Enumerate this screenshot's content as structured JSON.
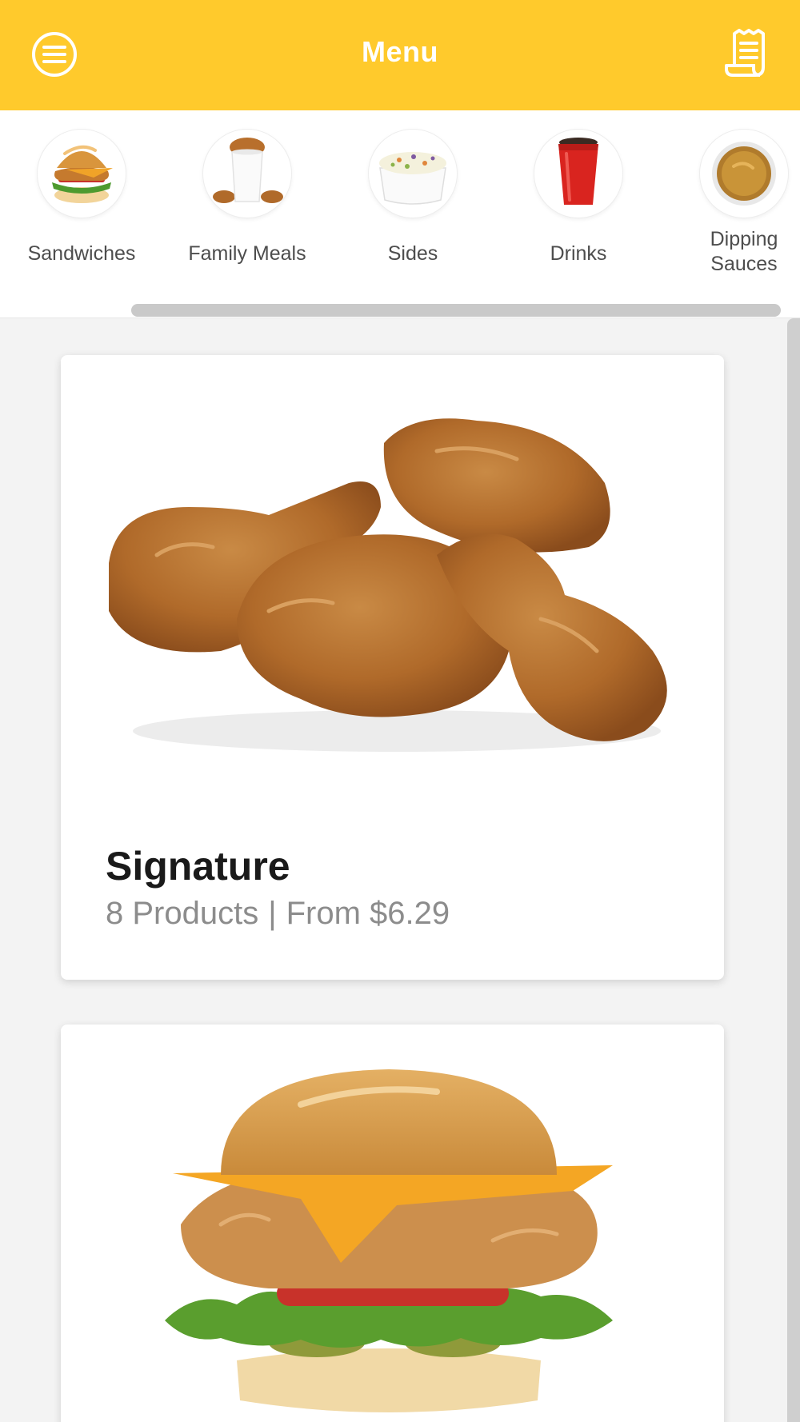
{
  "header": {
    "title": "Menu",
    "background_color": "#ffca2c",
    "left_icon": "hamburger-menu-icon",
    "right_icon": "receipt-icon"
  },
  "categories": [
    {
      "label": "Sandwiches",
      "icon": "chicken-sandwich"
    },
    {
      "label": "Family Meals",
      "icon": "chicken-bucket"
    },
    {
      "label": "Sides",
      "icon": "coleslaw-cup"
    },
    {
      "label": "Drinks",
      "icon": "drink-cup"
    },
    {
      "label": "Dipping Sauces",
      "icon": "sauce-cup"
    }
  ],
  "cards": [
    {
      "title": "Signature",
      "products": "8 Products",
      "separator": "|",
      "price": "From $6.29",
      "image": "fried-chicken-pieces"
    },
    {
      "title": "",
      "products": "",
      "separator": "",
      "price": "",
      "image": "chicken-sandwich"
    }
  ]
}
